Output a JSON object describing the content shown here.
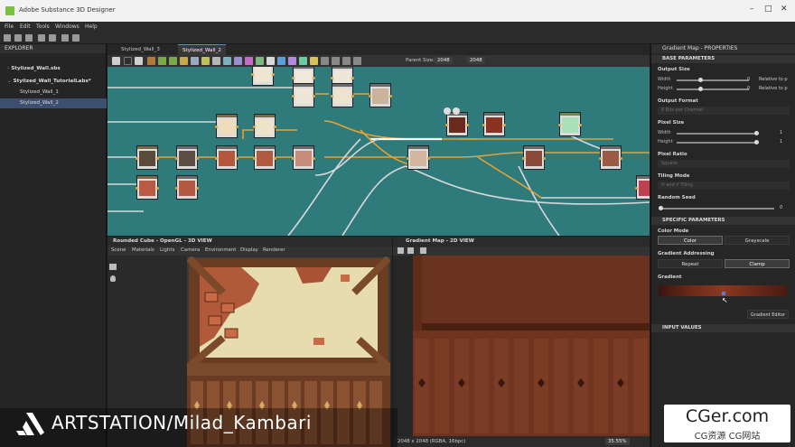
{
  "window": {
    "title": "Adobe Substance 3D Designer",
    "controls": [
      "–",
      "□",
      "✕"
    ]
  },
  "menu": [
    "File",
    "Edit",
    "Tools",
    "Windows",
    "Help"
  ],
  "explorer": {
    "title": "EXPLORER",
    "items": [
      {
        "label": "Stylized_Wall.sbs",
        "level": 0,
        "bold": true
      },
      {
        "label": "Stylized_Wall_TutorialLabs*",
        "level": 0,
        "bold": true
      },
      {
        "label": "Stylized_Wall_1",
        "level": 1,
        "bold": false
      },
      {
        "label": "Stylized_Wall_2",
        "level": 1,
        "bold": false,
        "selected": true
      }
    ]
  },
  "graph": {
    "tabs": [
      "Stylized_Wall_3",
      "Stylized_Wall_2"
    ],
    "active_tab": 1,
    "parent_size_label": "Parent Size:",
    "parent_size_value": "2048",
    "size_value": "2048",
    "background_color": "#2f7b7c"
  },
  "properties": {
    "title": "Gradient Map - PROPERTIES",
    "base_parameters": "BASE PARAMETERS",
    "output_size": {
      "label": "Output Size",
      "width_label": "Width",
      "height_label": "Height",
      "width_value": "0",
      "height_value": "0",
      "width_mode": "Relative to p",
      "height_mode": "Relative to p"
    },
    "output_format": {
      "label": "Output Format",
      "value": "8 Bits per Channel"
    },
    "pixel_size": {
      "label": "Pixel Size",
      "width_label": "Width",
      "height_label": "Height",
      "width_value": "1",
      "height_value": "1"
    },
    "pixel_ratio": {
      "label": "Pixel Ratio",
      "value": "Square"
    },
    "tiling_mode": {
      "label": "Tiling Mode",
      "value": "H and V Tiling"
    },
    "random_seed": {
      "label": "Random Seed",
      "value": "0"
    },
    "specific_parameters": "SPECIFIC PARAMETERS",
    "color_mode": {
      "label": "Color Mode",
      "options": [
        "Color",
        "Grayscale"
      ],
      "selected": 0
    },
    "gradient_addressing": {
      "label": "Gradient Addressing",
      "options": [
        "Repeat",
        "Clamp"
      ],
      "selected": 1
    },
    "gradient": {
      "label": "Gradient",
      "editor_button": "Gradient Editor"
    },
    "input_values": "INPUT VALUES"
  },
  "view3d": {
    "title": "Rounded Cube - OpenGL - 3D VIEW",
    "menu": [
      "Scene",
      "Materials",
      "Lights",
      "Camera",
      "Environment",
      "Display",
      "Renderer"
    ]
  },
  "view2d": {
    "title": "Gradient Map - 2D VIEW",
    "status": "2048 x 2048 (RGBA, 16bpc)",
    "zoom": "35.55%"
  },
  "watermark": {
    "text": "ARTSTATION/Milad_Kambari"
  },
  "site_badge": {
    "line1": "CGer.com",
    "line2": "CG资源 CG网站"
  }
}
